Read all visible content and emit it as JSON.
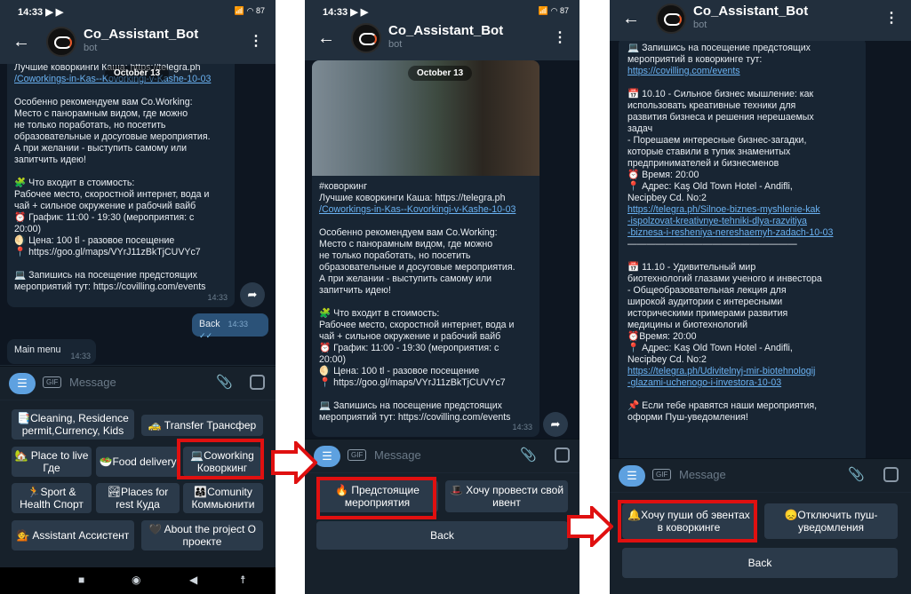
{
  "screens": [
    {
      "time": "14:33",
      "title": "Co_Assistant_Bot",
      "subtitle": "bot",
      "date_pill": "October 13",
      "message_lines": [
        "Лучшие коворкинги Каша: https://telegra.ph",
        "/Coworkings-in-Kas--Kovorkingi-v-Kashe-10-03",
        "",
        "Особенно рекомендуем вам Co.Working:",
        "Место с панорамным видом, где можно",
        "не только поработать, но посетить",
        "образовательные и досуговые мероприятия.",
        "А при желании - выступить самому или",
        "запитчить идею!",
        "",
        "🧩 Что входит в стоимость:",
        "Рабочее место, скоростной интернет, вода и",
        "чай + сильное окружение и рабочий вайб",
        "⏰ График: 11:00 - 19:30 (мероприятия: с",
        "20:00)",
        "🌖 Цена: 100 tl - разовое посещение",
        "📍 https://goo.gl/maps/VYrJ11zBkTjCUVYc7",
        "",
        "💻 Запишись на посещение предстоящих",
        "мероприятий тут: https://covilling.com/events"
      ],
      "message_time": "14:33",
      "sent_text": "Back",
      "sent_time": "14:33",
      "received_text": "Main menu",
      "received_time": "14:33",
      "input_placeholder": "Message",
      "keyboard": [
        "📑Cleaning, Residence permit,Currency, Kids",
        "🚕 Transfer Трансфер",
        "🏡 Place to live  Где",
        "🥗Food delivery",
        "💻Coworking Коворкинг",
        "🏃Sport & Health Спорт",
        "🏞Places for rest Куда",
        "👨‍👩‍👧Comunity Коммьюнити",
        "💁 Assistant Ассистент",
        "🖤 About the project О проекте"
      ]
    },
    {
      "time": "14:33",
      "title": "Co_Assistant_Bot",
      "subtitle": "bot",
      "date_pill": "October 13",
      "message_lines": [
        "#коворкинг",
        "Лучшие коворкинги Каша: https://telegra.ph",
        "/Coworkings-in-Kas--Kovorkingi-v-Kashe-10-03",
        "",
        "Особенно рекомендуем вам Co.Working:",
        "Место с панорамным видом, где можно",
        "не только поработать, но посетить",
        "образовательные и досуговые мероприятия.",
        "А при желании - выступить самому или",
        "запитчить идею!",
        "",
        "🧩 Что входит в стоимость:",
        "Рабочее место, скоростной интернет, вода и",
        "чай + сильное окружение и рабочий вайб",
        "⏰ График: 11:00 - 19:30 (мероприятия: с",
        "20:00)",
        "🌖 Цена: 100 tl - разовое посещение",
        "📍 https://goo.gl/maps/VYrJ11zBkTjCUVYc7",
        "",
        "💻 Запишись на посещение предстоящих",
        "мероприятий тут: https://covilling.com/events"
      ],
      "message_time": "14:33",
      "input_placeholder": "Message",
      "keyboard": [
        "🔥 Предстоящие мероприятия",
        "🎩 Хочу провести свой ивент",
        "Back"
      ]
    },
    {
      "title": "Co_Assistant_Bot",
      "subtitle": "bot",
      "message_lines": [
        "💻 Запишись на посещение предстоящих",
        "мероприятий в коворкинге тут:",
        "https://covilling.com/events",
        "",
        "📅 10.10 - Сильное бизнес мышление: как",
        "использовать креативные техники для",
        "развития бизнеса и решения нерешаемых",
        "задач",
        "- Порешаем интересные бизнес-загадки,",
        "которые ставили в тупик знаменитых",
        "предпринимателей и бизнесменов",
        "⏰ Время: 20:00",
        "📍 Адрес: Kaş Old Town Hotel - Andifli,",
        "Necipbey Cd. No:2",
        "https://telegra.ph/Silnoe-biznes-myshlenie-kak",
        "-ispolzovat-kreativnye-tehniki-dlya-razvitiya",
        "-biznesa-i-resheniya-nereshaemyh-zadach-10-03",
        "——————————————————",
        "",
        "📅 11.10 -  Удивительный мир",
        "биотехнологий глазами ученого и инвестора",
        "- Общеобразовательная лекция для",
        "широкой аудитории с интересными",
        "историческими примерами развития",
        "медицины и биотехнологий",
        "⏰Время: 20:00",
        "📍 Адрес: Kaş Old Town Hotel - Andifli,",
        "Necipbey Cd. No:2",
        "https://telegra.ph/Udivitelnyj-mir-biotehnologij",
        "-glazami-uchenogo-i-investora-10-03",
        "",
        "📌 Если тебе нравятся наши мероприятия,",
        "оформи Пуш-уведомления!"
      ],
      "input_placeholder": "Message",
      "keyboard": [
        "🔔Хочу пуши об эвентах в коворкинге",
        "😞Отключить пуш-уведомления",
        "Back"
      ]
    }
  ],
  "colors": {
    "highlight": "#e01010",
    "telegram_blue": "#5ea1e0",
    "link": "#6ab2f2"
  }
}
